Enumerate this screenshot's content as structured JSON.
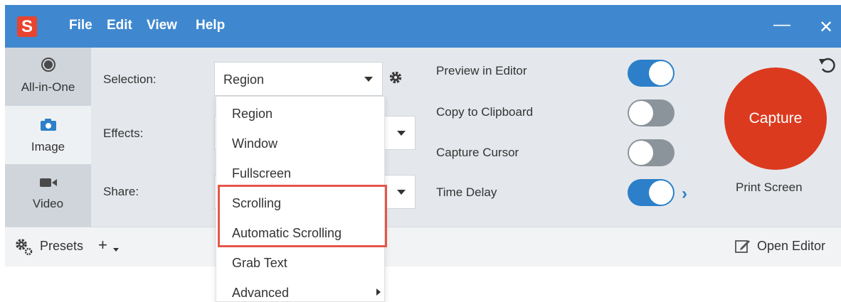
{
  "app": {
    "logo_letter": "S"
  },
  "menu": [
    "File",
    "Edit",
    "View",
    "Help"
  ],
  "window_controls": {
    "minimize": "—",
    "close": "✕"
  },
  "modes": [
    {
      "label": "All-in-One",
      "icon": "record-icon",
      "selected": false
    },
    {
      "label": "Image",
      "icon": "camera-icon",
      "selected": true
    },
    {
      "label": "Video",
      "icon": "video-camera-icon",
      "selected": false
    }
  ],
  "settings": {
    "selection_label": "Selection:",
    "selection_value": "Region",
    "effects_label": "Effects:",
    "share_label": "Share:"
  },
  "dropdown": {
    "items": [
      "Region",
      "Window",
      "Fullscreen",
      "Scrolling",
      "Automatic Scrolling",
      "Grab Text",
      "Advanced"
    ],
    "highlighted": [
      "Scrolling",
      "Automatic Scrolling"
    ],
    "highlight_color": "#e5564a"
  },
  "options": [
    {
      "label": "Preview in Editor",
      "on": true
    },
    {
      "label": "Copy to Clipboard",
      "on": false
    },
    {
      "label": "Capture Cursor",
      "on": false
    },
    {
      "label": "Time Delay",
      "on": true
    }
  ],
  "capture": {
    "label": "Capture",
    "hotkey": "Print Screen",
    "color": "#dc3a1f"
  },
  "footer": {
    "presets": "Presets",
    "add": "+",
    "open_editor": "Open Editor"
  },
  "colors": {
    "titlebar": "#3f88cf",
    "toggle_on": "#2c7fc8",
    "toggle_off": "#8c949b"
  }
}
